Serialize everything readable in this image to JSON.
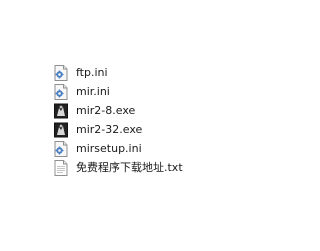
{
  "files": [
    {
      "name": "ftp.ini",
      "icon": "settings-file-icon"
    },
    {
      "name": "mir.ini",
      "icon": "settings-file-icon"
    },
    {
      "name": "mir2-8.exe",
      "icon": "application-icon"
    },
    {
      "name": "mir2-32.exe",
      "icon": "application-icon"
    },
    {
      "name": "mirsetup.ini",
      "icon": "settings-file-icon"
    },
    {
      "name": "免费程序下载地址.txt",
      "icon": "text-file-icon"
    }
  ],
  "colors": {
    "background": "#ffffff",
    "text": "#1a1a1a",
    "ini_gear": "#4a7fc1",
    "exe_icon": "#222222"
  }
}
